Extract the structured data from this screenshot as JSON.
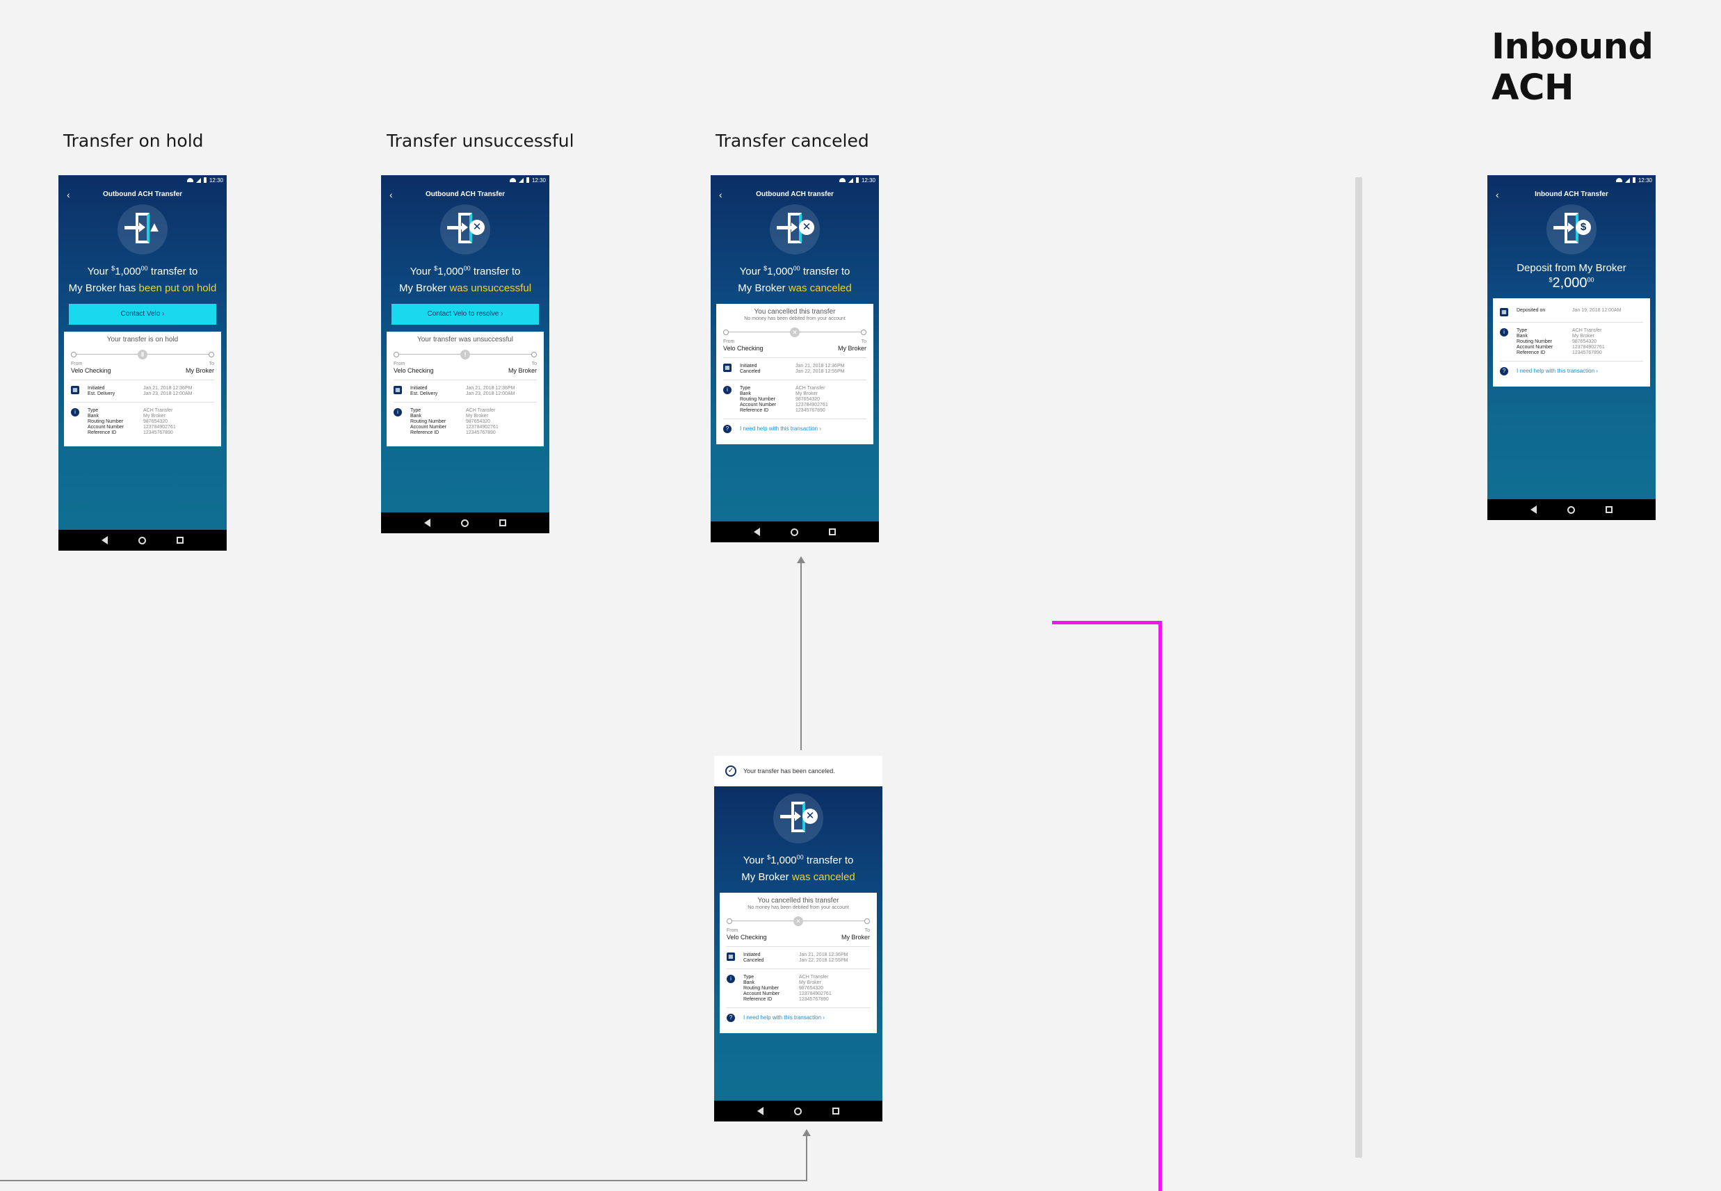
{
  "board_title": "Inbound ACH",
  "columns": {
    "hold": "Transfer on hold",
    "unsuccessful": "Transfer unsuccessful",
    "canceled": "Transfer canceled"
  },
  "status_time": "12:30",
  "colors": {
    "accent": "#19d9ef",
    "highlight": "#f2d22c",
    "navy": "#0b2f66",
    "flow_line": "#ee18ee"
  },
  "hold": {
    "nav_title": "Outbound ACH Transfer",
    "headline_a": "Your ",
    "amount_sup": "$",
    "amount_main": "1,000",
    "amount_cents": "00",
    "headline_b": " transfer to",
    "headline_c": "My Broker has ",
    "headline_hl": "been put on hold",
    "cta": "Contact Velo ›",
    "card_title": "Your transfer is on hold",
    "from_label": "From",
    "to_label": "To",
    "from_account": "Velo Checking",
    "to_account": "My Broker",
    "dates": [
      [
        "Initiated",
        "Jan 21, 2018  12:36PM"
      ],
      [
        "Est. Delivery",
        "Jan 23, 2018  12:00AM"
      ]
    ],
    "details": [
      [
        "Type",
        "ACH Transfer"
      ],
      [
        "Bank",
        "My Broker"
      ],
      [
        "Routing Number",
        "987654320"
      ],
      [
        "Account Number",
        "123784902761"
      ],
      [
        "Reference ID",
        "12345767890"
      ]
    ]
  },
  "unsuccessful": {
    "nav_title": "Outbound ACH Transfer",
    "headline_a": "Your ",
    "amount_sup": "$",
    "amount_main": "1,000",
    "amount_cents": "00",
    "headline_b": " transfer to",
    "headline_c": "My Broker ",
    "headline_hl": "was unsuccessful",
    "cta": "Contact Velo to resolve ›",
    "card_title": "Your transfer was unsuccessful",
    "from_label": "From",
    "to_label": "To",
    "from_account": "Velo Checking",
    "to_account": "My Broker",
    "dates": [
      [
        "Initiated",
        "Jan 21, 2018  12:36PM"
      ],
      [
        "Est. Delivery",
        "Jan 23, 2018  12:00AM"
      ]
    ],
    "details": [
      [
        "Type",
        "ACH Transfer"
      ],
      [
        "Bank",
        "My Broker"
      ],
      [
        "Routing Number",
        "987654320"
      ],
      [
        "Account Number",
        "123784902761"
      ],
      [
        "Reference ID",
        "12345767890"
      ]
    ]
  },
  "canceled": {
    "nav_title": "Outbound ACH transfer",
    "headline_a": "Your ",
    "amount_sup": "$",
    "amount_main": "1,000",
    "amount_cents": "00",
    "headline_b": " transfer to",
    "headline_c": "My Broker ",
    "headline_hl": "was canceled",
    "card_title": "You cancelled this transfer",
    "card_sub": "No money has been debited from your account",
    "from_label": "From",
    "to_label": "To",
    "from_account": "Velo Checking",
    "to_account": "My Broker",
    "dates": [
      [
        "Initiated",
        "Jan 21, 2018  12:36PM"
      ],
      [
        "Canceled",
        "Jan 22, 2018  12:55PM"
      ]
    ],
    "details": [
      [
        "Type",
        "ACH Transfer"
      ],
      [
        "Bank",
        "My Broker"
      ],
      [
        "Routing Number",
        "987654320"
      ],
      [
        "Account Number",
        "123784902761"
      ],
      [
        "Reference ID",
        "12345767890"
      ]
    ],
    "help": "I need help with this transaction ›"
  },
  "toast": "Your transfer has been canceled.",
  "inbound": {
    "nav_title": "Inbound ACH Transfer",
    "headline": "Deposit from My Broker",
    "amount_sup": "$",
    "amount_main": "2,000",
    "amount_cents": "00",
    "deposited": [
      "Deposited on",
      "Jan 19, 2018  12:00AM"
    ],
    "details": [
      [
        "Type",
        "ACH Transfer"
      ],
      [
        "Bank",
        "My Broker"
      ],
      [
        "Routing Number",
        "987654320"
      ],
      [
        "Account Number",
        "123784902761"
      ],
      [
        "Reference ID",
        "12345767890"
      ]
    ],
    "help": "I need help with this transaction ›"
  }
}
